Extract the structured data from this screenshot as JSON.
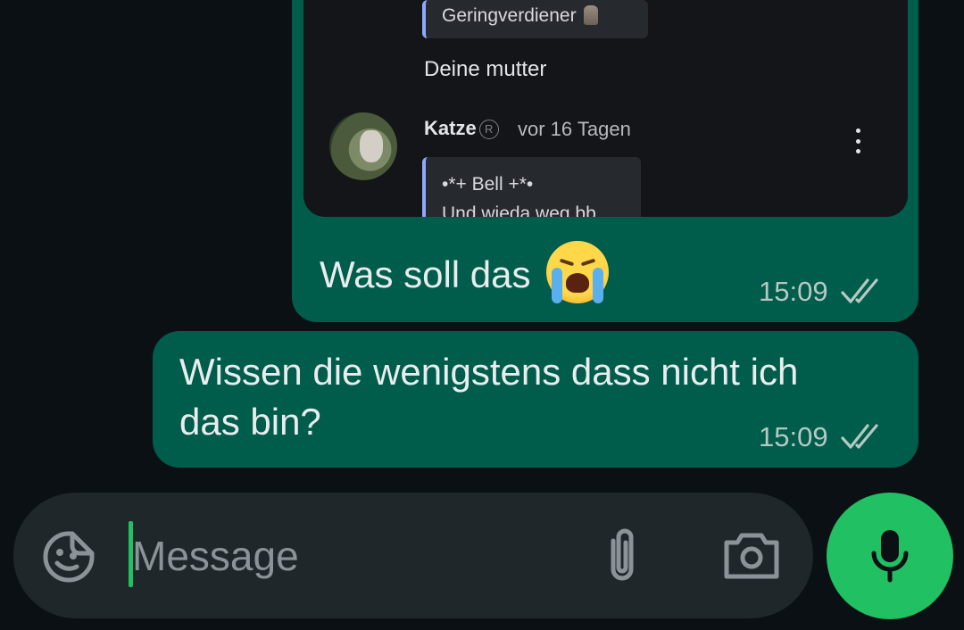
{
  "colors": {
    "background": "#0b1014",
    "outgoing_bubble": "#005c4b",
    "input_bar": "#1f272b",
    "accent_green": "#21c063",
    "read_ticks": "#b4c9c3"
  },
  "attachment": {
    "quote_top": "Geringverdiener",
    "comment_text": "Deine mutter",
    "username": "Katze",
    "registered_mark": "R",
    "time_ago": "vor 16 Tagen",
    "quote_name": "•*+ Bell +*•",
    "quote_text": "Und wieda weg bb"
  },
  "messages": [
    {
      "text": "Was soll das",
      "emoji": "loudly-crying-face",
      "time": "15:09",
      "status": "read"
    },
    {
      "text": "Wissen die wenigstens dass nicht ich das bin?",
      "time": "15:09",
      "status": "read"
    }
  ],
  "composer": {
    "placeholder": "Message",
    "sticker_icon": "sticker-icon",
    "attach_icon": "paperclip-icon",
    "camera_icon": "camera-icon",
    "mic_icon": "microphone-icon"
  }
}
